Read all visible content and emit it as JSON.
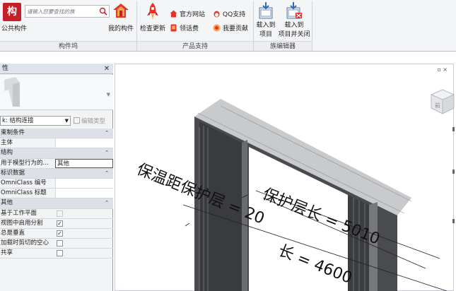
{
  "ribbon": {
    "logo_text": "构",
    "public_components": "公共构件",
    "search": {
      "placeholder": "请输入您要查找的族"
    },
    "my_components": "我的构件",
    "check_update": "检查更新",
    "official_site": "官方网站",
    "qq_support": "QQ支持",
    "collect_fee": "领话费",
    "contribute": "我要贡献",
    "load_project_l1": "载入到",
    "load_project_l2": "项目",
    "load_close_l1": "载入到",
    "load_close_l2": "项目并关闭",
    "groups": {
      "components": "构件坞",
      "product_support": "产品支持",
      "family_editor": "族编辑器"
    }
  },
  "properties": {
    "title": "性",
    "type_value": "k: 结构连接",
    "edit_type": "编辑类型",
    "rows": [
      {
        "kind": "cat",
        "label": "束制条件"
      },
      {
        "kind": "kv",
        "label": "主体",
        "value": ""
      },
      {
        "kind": "cat",
        "label": "结构"
      },
      {
        "kind": "kv",
        "label": "用于模型行为的...",
        "value": "其他"
      },
      {
        "kind": "cat",
        "label": "标识数据"
      },
      {
        "kind": "kv",
        "label": "OmniClass 编号",
        "value": ""
      },
      {
        "kind": "kv",
        "label": "OmniClass 标题",
        "value": ""
      },
      {
        "kind": "cat",
        "label": "其他"
      },
      {
        "kind": "cb",
        "label": "基于工作平面",
        "checked": false,
        "enabled": false
      },
      {
        "kind": "cb",
        "label": "视图中启用分割",
        "checked": true,
        "enabled": true
      },
      {
        "kind": "cb",
        "label": "总是垂直",
        "checked": true,
        "enabled": true
      },
      {
        "kind": "cb",
        "label": "加载时剪切的空心",
        "checked": false,
        "enabled": true
      },
      {
        "kind": "cb",
        "label": "共享",
        "checked": false,
        "enabled": true
      }
    ]
  },
  "viewport": {
    "annotation_1": "保温距保护层 = 20",
    "annotation_2": "保护层长 = 5010",
    "annotation_3": "长 = 4600",
    "cube_face": "前"
  },
  "colors": {
    "accent_red": "#c5202a",
    "ribbon_bg": "#f4f5f7",
    "wall_dark": "#3a3b3e"
  }
}
